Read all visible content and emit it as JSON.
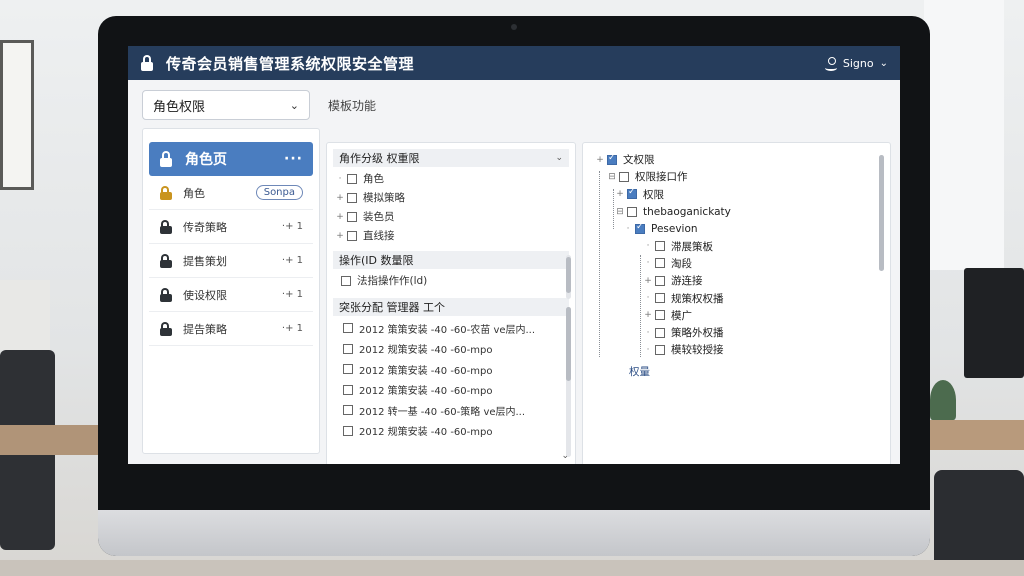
{
  "app": {
    "title": "传奇会员销售管理系统权限安全管理",
    "user_label": "Signo",
    "user_chevron": "⌄"
  },
  "toolbar": {
    "role_select_value": "角色权限",
    "select_chevron": "⌄",
    "secondary_label": "模板功能"
  },
  "roles": {
    "active": {
      "label": "角色页",
      "more": "···"
    },
    "items": [
      {
        "label": "角色",
        "tail": "Sonpa",
        "style": "pill"
      },
      {
        "label": "传奇策略",
        "tail": "·+ 1",
        "style": "plain"
      },
      {
        "label": "提售策划",
        "tail": "·+ 1",
        "style": "plain"
      },
      {
        "label": "使设权限",
        "tail": "·+ 1",
        "style": "plain"
      },
      {
        "label": "提告策略",
        "tail": "·+ 1",
        "style": "plain"
      }
    ]
  },
  "middle": {
    "group1": {
      "title": "角作分级 权重限",
      "chevron": "⌄",
      "items": [
        "角色",
        "模拟策略",
        "装色员",
        "直线接"
      ]
    },
    "group2": {
      "title": "操作(ID 数量限",
      "items": [
        "法指操作作(ld)"
      ]
    },
    "group3": {
      "title": "突张分配 管理器 工个",
      "items": [
        "2012 策策安装 -40 -60-农苗 ve层内...",
        "2012 规策安装 -40 -60-mpo",
        "2012 策策安装 -40 -60-mpo",
        "2012 策策安装 -40 -60-mpo",
        "2012 转一基 -40 -60-策略 ve层内...",
        "2012 规策安装 -40 -60-mpo"
      ],
      "chevron_bottom": "⌄"
    }
  },
  "right": {
    "rows": [
      {
        "indent": 0,
        "label": "文权限",
        "checked": true,
        "twig": "+"
      },
      {
        "indent": 1,
        "label": "权限接口作",
        "checked": false,
        "twig": "⊟"
      },
      {
        "indent": 2,
        "label": "权限",
        "checked": true,
        "twig": "+"
      },
      {
        "indent": 2,
        "label": "thebaoganickaty",
        "checked": false,
        "twig": "⊟"
      },
      {
        "indent": 3,
        "label": "Pesevion",
        "checked": true,
        "twig": "·"
      },
      {
        "indent": 4,
        "label": "滞展策板",
        "checked": false,
        "twig": "·"
      },
      {
        "indent": 4,
        "label": "淘段",
        "checked": false,
        "twig": "·"
      },
      {
        "indent": 4,
        "label": "游连接",
        "checked": false,
        "twig": "+"
      },
      {
        "indent": 4,
        "label": "规策权权播",
        "checked": false,
        "twig": "·"
      },
      {
        "indent": 4,
        "label": "模广",
        "checked": false,
        "twig": "+"
      },
      {
        "indent": 4,
        "label": "策略外权播",
        "checked": false,
        "twig": "·"
      },
      {
        "indent": 4,
        "label": "模较较授接",
        "checked": false,
        "twig": "·"
      }
    ],
    "footer_label": "权量"
  }
}
